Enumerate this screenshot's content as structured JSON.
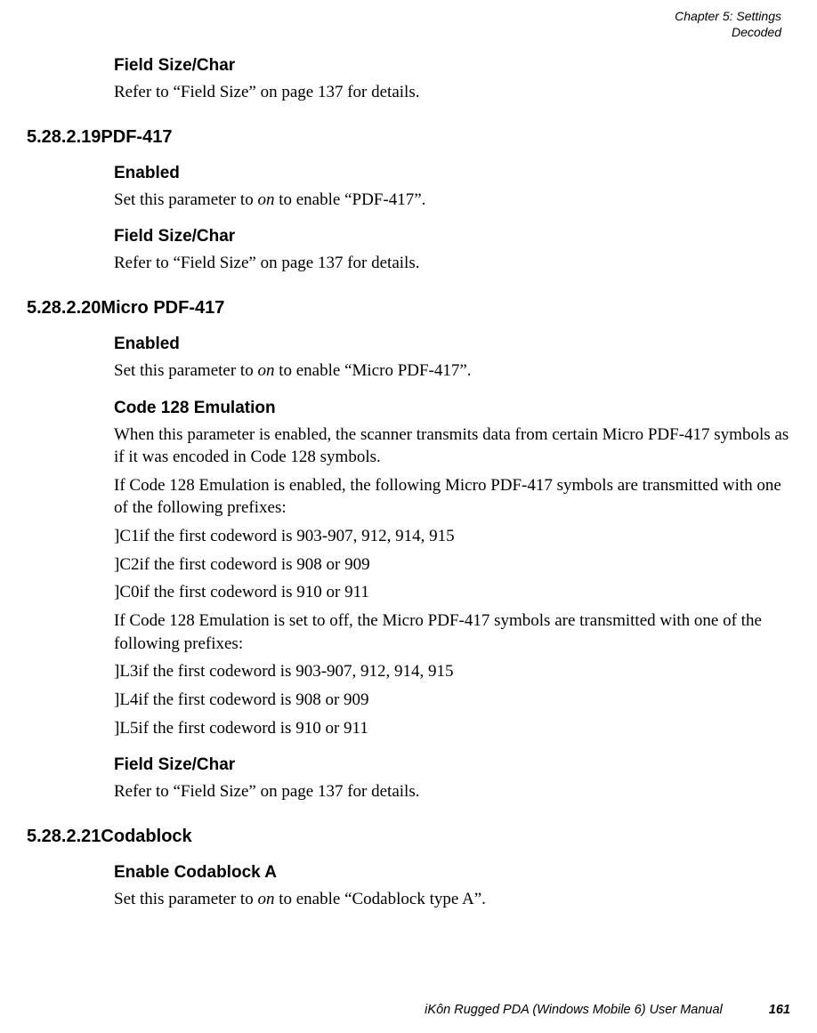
{
  "header": {
    "chapter_line": "Chapter 5:  Settings",
    "section_line": "Decoded"
  },
  "sections": {
    "intro": {
      "h_fsc": "Field Size/Char",
      "p_fsc": "Refer to “Field Size” on page 137 for details."
    },
    "s19": {
      "num": "5.28.2.19",
      "title": "PDF-417",
      "h_enabled": "Enabled",
      "p_enabled_pre": "Set this parameter to ",
      "p_enabled_ital": "on",
      "p_enabled_post": " to enable “PDF-417”.",
      "h_fsc": "Field Size/Char",
      "p_fsc": "Refer to “Field Size” on page 137 for details."
    },
    "s20": {
      "num": "5.28.2.20",
      "title": "Micro PDF-417",
      "h_enabled": "Enabled",
      "p_enabled_pre": "Set this parameter to ",
      "p_enabled_ital": "on",
      "p_enabled_post": " to enable “Micro PDF-417”.",
      "h_c128": "Code 128 Emulation",
      "p_c128_a": "When this parameter is enabled, the scanner transmits data from certain Micro PDF-417 symbols as if it was encoded in Code 128 symbols.",
      "p_c128_b": "If Code 128 Emulation is enabled, the following Micro PDF-417 symbols are transmitted with one of the following prefixes:",
      "p_c128_c1": "]C1if the first codeword is 903-907, 912, 914, 915",
      "p_c128_c2": "]C2if the first codeword is 908 or 909",
      "p_c128_c0": "]C0if the first codeword is 910 or 911",
      "p_c128_c": "If Code 128 Emulation is set to off, the Micro PDF-417 symbols are transmitted with one of the following prefixes:",
      "p_c128_l3": "]L3if the first codeword is 903-907, 912, 914, 915",
      "p_c128_l4": "]L4if the first codeword is 908 or 909",
      "p_c128_l5": "]L5if the first codeword is 910 or 911",
      "h_fsc": "Field Size/Char",
      "p_fsc": "Refer to “Field Size” on page 137 for details."
    },
    "s21": {
      "num": "5.28.2.21",
      "title": "Codablock",
      "h_ena": "Enable Codablock A",
      "p_ena_pre": "Set this parameter to ",
      "p_ena_ital": "on",
      "p_ena_post": " to enable “Codablock type A”."
    }
  },
  "footer": {
    "title": "iKôn Rugged PDA (Windows Mobile 6) User Manual",
    "page": "161"
  }
}
